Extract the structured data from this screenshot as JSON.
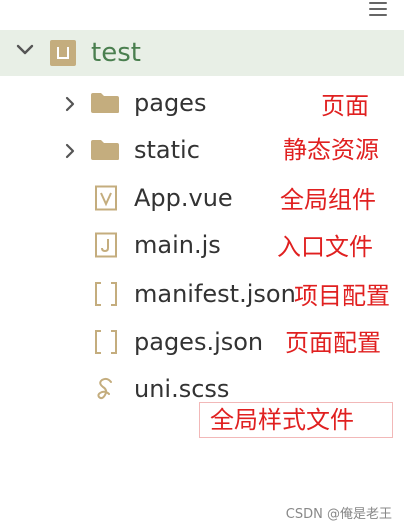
{
  "toolbar": {
    "menu_icon": "hamburger-menu-icon"
  },
  "project": {
    "name": "test",
    "expanded": true,
    "icon": "project-icon",
    "highlight_color": "#e8efe6",
    "name_color": "#4a7f4f"
  },
  "tree": [
    {
      "label": "pages",
      "type": "folder",
      "icon": "folder-icon",
      "annotation": "页面"
    },
    {
      "label": "static",
      "type": "folder",
      "icon": "folder-icon",
      "annotation": "静态资源"
    },
    {
      "label": "App.vue",
      "type": "file",
      "icon": "vue-file-icon",
      "annotation": "全局组件"
    },
    {
      "label": "main.js",
      "type": "file",
      "icon": "js-file-icon",
      "annotation": "入口文件"
    },
    {
      "label": "manifest.json",
      "type": "file",
      "icon": "json-file-icon",
      "annotation": "项目配置"
    },
    {
      "label": "pages.json",
      "type": "file",
      "icon": "json-file-icon",
      "annotation": "页面配置"
    },
    {
      "label": "uni.scss",
      "type": "file",
      "icon": "sass-file-icon",
      "annotation": "全局样式文件"
    }
  ],
  "colors": {
    "annotation": "#e02020",
    "icon": "#c4ad7e"
  },
  "watermark": "CSDN @俺是老王"
}
